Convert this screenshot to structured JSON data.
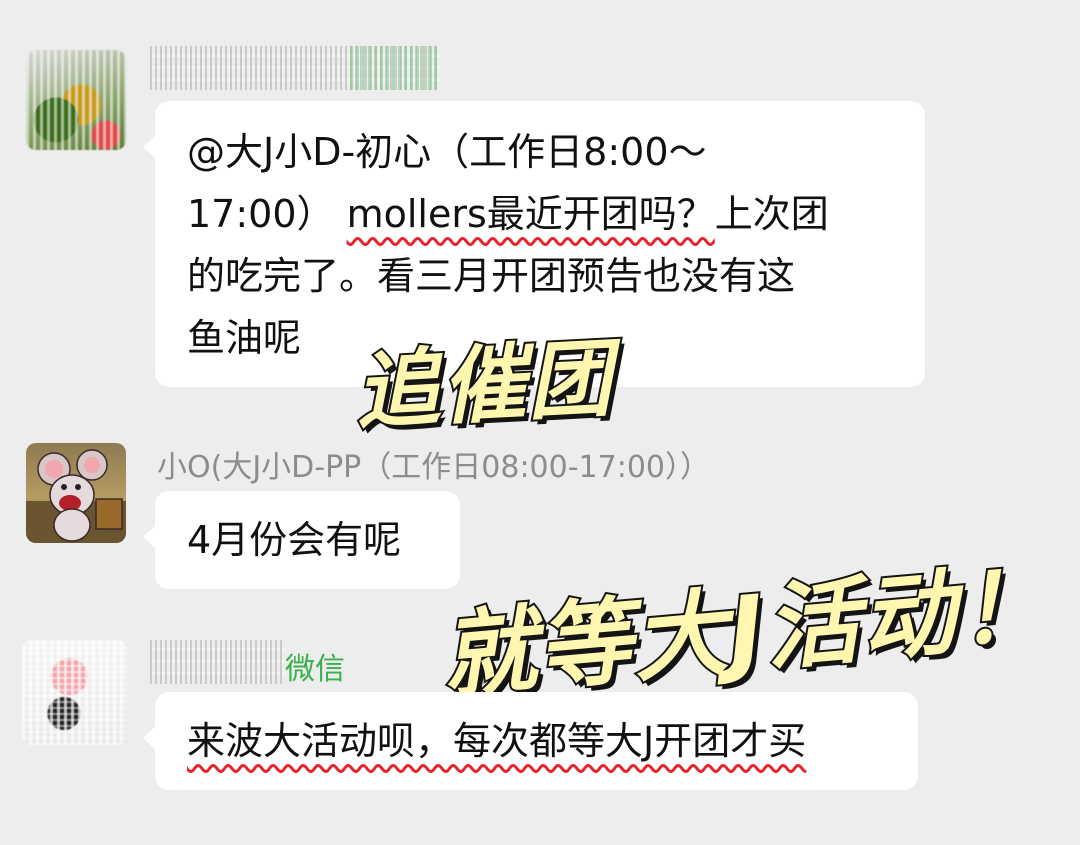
{
  "messages": [
    {
      "lines": [
        "@大J小D-初心（工作日8:00～",
        [
          "17:00） ",
          "mollers最近开团吗？",
          "上次团"
        ],
        "的吃完了。看三月开团预告也没有这",
        "鱼油呢"
      ]
    },
    {
      "sender": "小O(大J小D-PP（工作日08:00-17:00））",
      "text": "4月份会有呢"
    },
    {
      "sender_tail": "微信",
      "text": "来波大活动呗，每次都等大J开团才买"
    }
  ],
  "stickers": {
    "first": "追催团",
    "second": "就等大J活动！"
  },
  "icons": [
    "blurred-avatar-icon",
    "cartoon-mouse-avatar-icon"
  ],
  "colors": {
    "background": "#ededed",
    "bubble": "#ffffff",
    "underline": "#e8232b",
    "sticker_fill": "#fff7b0"
  }
}
